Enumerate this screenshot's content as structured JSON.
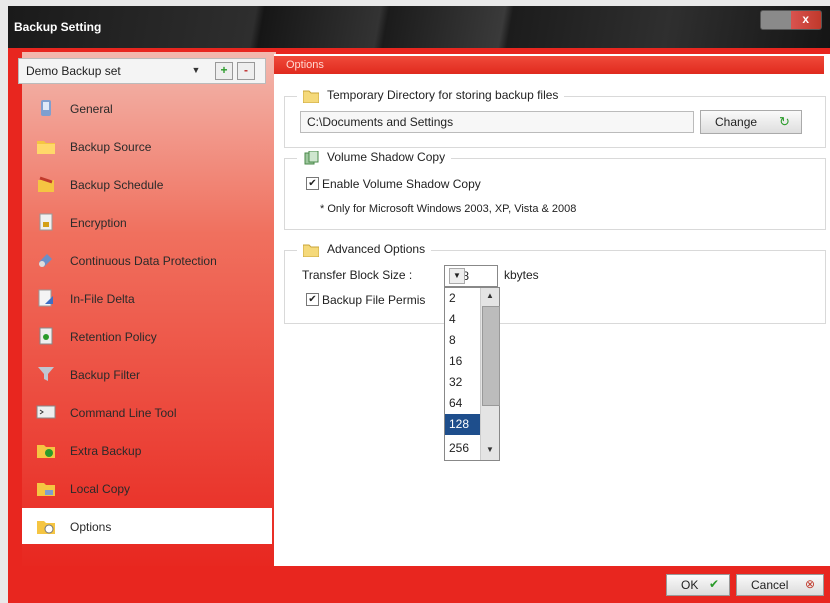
{
  "window": {
    "title": "Backup Setting",
    "close_glyph": "x"
  },
  "backup_set": {
    "selected": "Demo Backup set",
    "add_label": "+",
    "remove_label": "-"
  },
  "nav": {
    "items": [
      {
        "label": "General",
        "icon": "general-icon"
      },
      {
        "label": "Backup Source",
        "icon": "folder-icon"
      },
      {
        "label": "Backup Schedule",
        "icon": "schedule-icon"
      },
      {
        "label": "Encryption",
        "icon": "encryption-icon"
      },
      {
        "label": "Continuous Data Protection",
        "icon": "cdp-icon"
      },
      {
        "label": "In-File Delta",
        "icon": "delta-icon"
      },
      {
        "label": "Retention Policy",
        "icon": "retention-icon"
      },
      {
        "label": "Backup Filter",
        "icon": "filter-icon"
      },
      {
        "label": "Command Line Tool",
        "icon": "terminal-icon"
      },
      {
        "label": "Extra Backup",
        "icon": "extra-backup-icon"
      },
      {
        "label": "Local Copy",
        "icon": "local-copy-icon"
      },
      {
        "label": "Options",
        "icon": "options-icon"
      }
    ],
    "active": "Options"
  },
  "options": {
    "header": "Options",
    "temp_dir": {
      "heading": "Temporary Directory for storing backup files",
      "value": "C:\\Documents and Settings",
      "change_label": "Change"
    },
    "vss": {
      "heading": "Volume Shadow Copy",
      "enable_label": "Enable Volume Shadow Copy",
      "enabled": true,
      "note": "* Only for Microsoft Windows 2003, XP, Vista & 2008"
    },
    "advanced": {
      "heading": "Advanced Options",
      "block_size_label": "Transfer Block Size :",
      "block_size_value": "128",
      "block_size_unit": "kbytes",
      "permission_label": "Backup File Permis",
      "permission_checked": true,
      "block_size_options": [
        "2",
        "4",
        "8",
        "16",
        "32",
        "64",
        "128",
        "256"
      ]
    }
  },
  "footer": {
    "ok_label": "OK",
    "cancel_label": "Cancel"
  },
  "colors": {
    "accent": "#e8261f",
    "selection": "#1e4e8c"
  }
}
